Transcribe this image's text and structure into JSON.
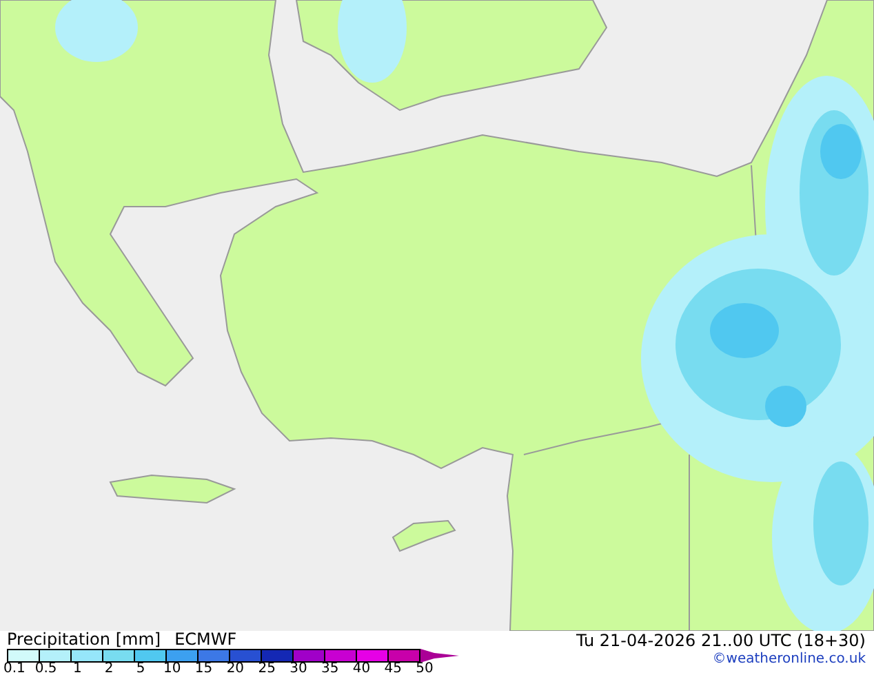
{
  "legend": {
    "title": "Precipitation [mm]",
    "model": "ECMWF",
    "bins": [
      {
        "color": "#d2fafa",
        "label": "0.1"
      },
      {
        "color": "#b4f0fa",
        "label": "0.5"
      },
      {
        "color": "#96e6fa",
        "label": "1"
      },
      {
        "color": "#78dcf0",
        "label": "2"
      },
      {
        "color": "#50c8f0",
        "label": "5"
      },
      {
        "color": "#3ca0f0",
        "label": "10"
      },
      {
        "color": "#3c78e6",
        "label": "15"
      },
      {
        "color": "#2850d2",
        "label": "20"
      },
      {
        "color": "#1428b4",
        "label": "25"
      },
      {
        "color": "#a000c8",
        "label": "30"
      },
      {
        "color": "#c800d2",
        "label": "35"
      },
      {
        "color": "#e600e6",
        "label": "40"
      },
      {
        "color": "#c800aa",
        "label": "45"
      }
    ],
    "overflow": {
      "color": "#aa0096"
    },
    "last_label": "50"
  },
  "valid_time": "Tu 21-04-2026 21..00 UTC (18+30)",
  "credit": "©weatheronline.co.uk"
}
